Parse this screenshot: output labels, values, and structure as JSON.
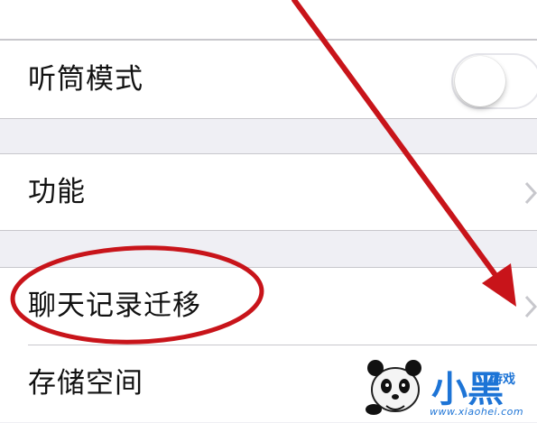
{
  "settings": {
    "items": [
      {
        "label": "听筒模式",
        "control": "toggle",
        "toggle_on": false
      },
      {
        "label": "功能",
        "control": "chevron"
      },
      {
        "label": "聊天记录迁移",
        "control": "chevron"
      },
      {
        "label": "存储空间",
        "control": "chevron"
      }
    ]
  },
  "watermark": {
    "brand": "小黑",
    "sub": "游戏",
    "url": "www.xiaohei.com"
  },
  "colors": {
    "background": "#efeff4",
    "cell": "#ffffff",
    "separator": "#c8c7cc",
    "annotation": "#c8141a",
    "watermark": "#1d74d6"
  }
}
